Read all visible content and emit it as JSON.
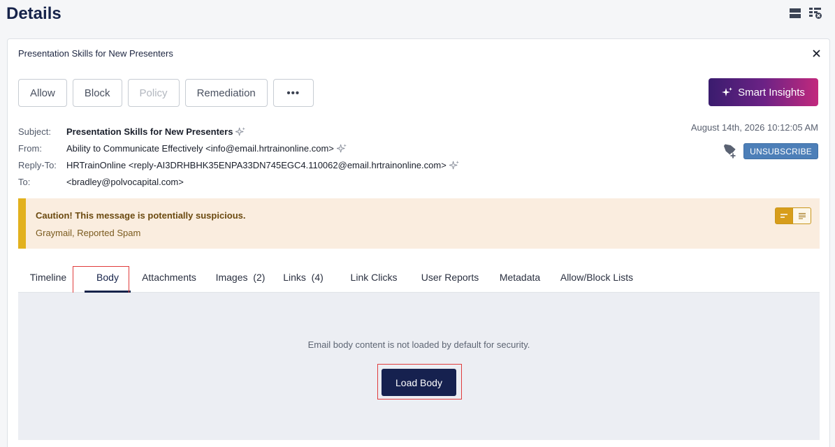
{
  "page": {
    "title": "Details"
  },
  "card": {
    "title": "Presentation Skills for New Presenters"
  },
  "actions": [
    {
      "label": "Allow",
      "disabled": false
    },
    {
      "label": "Block",
      "disabled": false
    },
    {
      "label": "Policy",
      "disabled": true
    },
    {
      "label": "Remediation",
      "disabled": false
    },
    {
      "label": "•••",
      "disabled": false
    }
  ],
  "smart_insights": {
    "label": "Smart Insights"
  },
  "email": {
    "subject_label": "Subject:",
    "subject": "Presentation Skills for New Presenters",
    "from_label": "From:",
    "from": "Ability to Communicate Effectively <info@email.hrtrainonline.com>",
    "reply_to_label": "Reply-To:",
    "reply_to": "HRTrainOnline <reply-AI3DRHBHK35ENPA33DN745EGC4.110062@email.hrtrainonline.com>",
    "to_label": "To:",
    "to": "<bradley@polvocapital.com>",
    "date": "August 14th, 2026 10:12:05 AM"
  },
  "unsubscribe": {
    "label": "UNSUBSCRIBE"
  },
  "caution": {
    "title": "Caution!  This message is potentially suspicious.",
    "subtitle": "Graymail, Reported Spam"
  },
  "tabs": [
    {
      "label": "Timeline"
    },
    {
      "label": "Body",
      "active": true
    },
    {
      "label": "Attachments"
    },
    {
      "label": "Images  (2)"
    },
    {
      "label": "Links  (4)"
    },
    {
      "label": "Link Clicks"
    },
    {
      "label": "User Reports"
    },
    {
      "label": "Metadata"
    },
    {
      "label": "Allow/Block Lists"
    }
  ],
  "body_panel": {
    "message": "Email body content is not loaded by default for security.",
    "load_button": "Load Body"
  },
  "colors": {
    "accent_navy": "#16234a",
    "caution_bar": "#e2b11e",
    "caution_bg": "#faeddf",
    "highlight_red": "#e03c3c"
  }
}
